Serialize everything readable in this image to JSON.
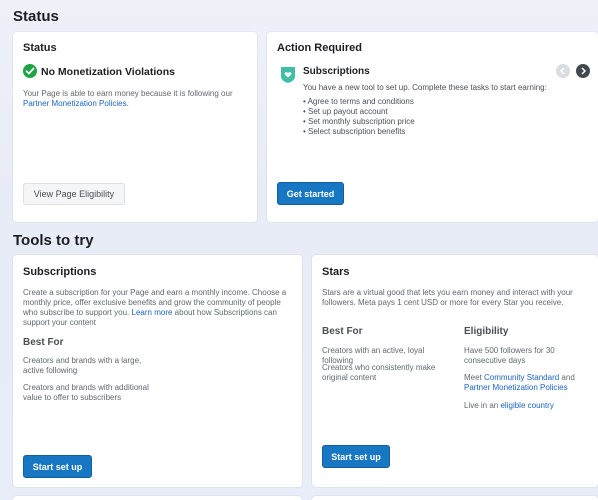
{
  "status_section": {
    "title": "Status",
    "status_card": {
      "title": "Status",
      "headline": "No Monetization Violations",
      "desc_prefix": "Your Page is able to earn money because it is following our",
      "desc_link": "Partner Monetization Policies",
      "desc_suffix": ".",
      "button": "View Page Eligibility"
    },
    "action_card": {
      "title": "Action Required",
      "item_title": "Subscriptions",
      "item_desc": "You have a new tool to set up. Complete these tasks to start earning:",
      "tasks": [
        "• Agree to terms and conditions",
        "• Set up payout account",
        "• Set monthly subscription price",
        "• Select subscription benefits"
      ],
      "button": "Get started"
    }
  },
  "tools_section": {
    "title": "Tools to try",
    "subscriptions_card": {
      "title": "Subscriptions",
      "desc": "Create a subscription for your Page and earn a monthly income. Choose a monthly price, offer exclusive benefits and grow the community of people who subscribe to support you.",
      "desc_link": "Learn more",
      "desc_suffix": "about how Subscriptions can support your content",
      "best_for_title": "Best For",
      "best_for_1": "Creators and brands with a large, active following",
      "best_for_2": "Creators and brands with additional value to offer to subscribers",
      "button": "Start set up"
    },
    "stars_card": {
      "title": "Stars",
      "desc": "Stars are a virtual good that lets you earn money and interact with your followers. Meta pays 1 cent USD or more for every Star you receive.",
      "best_for_title": "Best For",
      "best_for_1": "Creators with an active, loyal following",
      "best_for_2": "Creators who consistently make original content",
      "eligibility_title": "Eligibility",
      "elig_1": "Have 500 followers for 30 consecutive days",
      "elig_2_prefix": "Meet",
      "elig_2_link1": "Community Standard",
      "elig_2_and": "and",
      "elig_2_link2": "Partner Monetization Policies",
      "elig_3_prefix": "Live in an",
      "elig_3_link": "eligible country",
      "button": "Start set up"
    }
  },
  "colors": {
    "accent": "#1877c2",
    "success": "#20a345",
    "icon_teal": "#3fbfa8"
  }
}
